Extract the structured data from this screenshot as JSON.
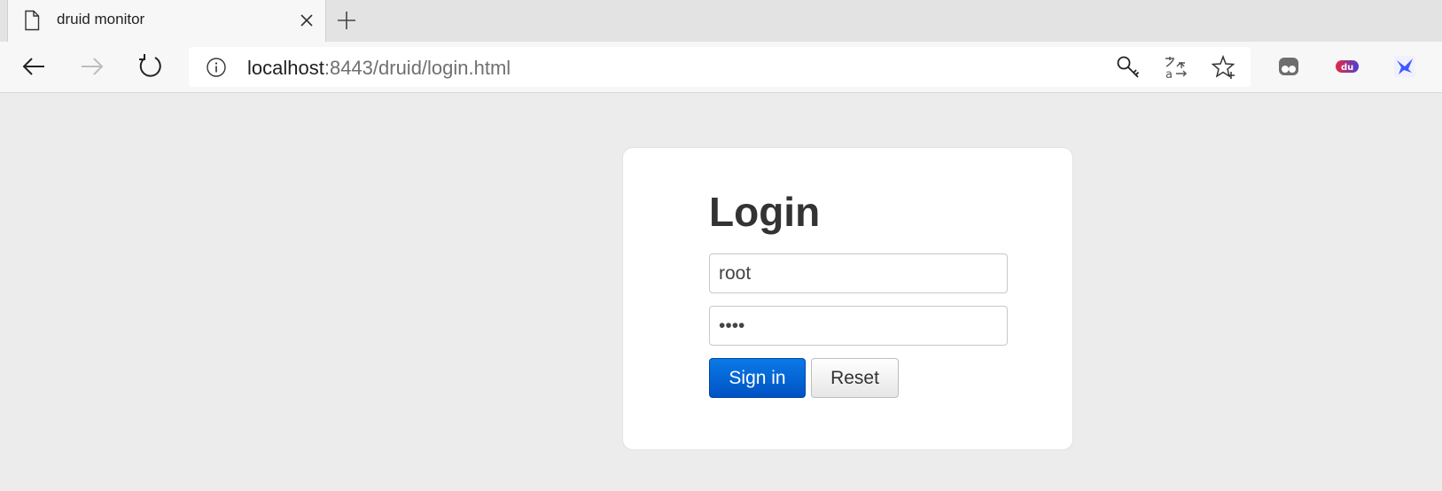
{
  "browser": {
    "tab": {
      "title": "druid monitor"
    },
    "address": {
      "host": "localhost",
      "rest": ":8443/druid/login.html"
    },
    "icons": {
      "page": "page-icon",
      "close": "close-icon",
      "new_tab": "plus-icon",
      "back": "back-arrow-icon",
      "forward": "forward-arrow-icon",
      "refresh": "refresh-icon",
      "info": "info-icon",
      "key": "key-icon",
      "translate": "translate-icon",
      "favorite": "star-plus-icon",
      "ext1": "extension-eyes-icon",
      "ext2": "extension-du-icon",
      "ext3": "extension-bird-icon"
    }
  },
  "login": {
    "title": "Login",
    "username_value": "root",
    "password_value": "1234",
    "signin_label": "Sign in",
    "reset_label": "Reset"
  }
}
